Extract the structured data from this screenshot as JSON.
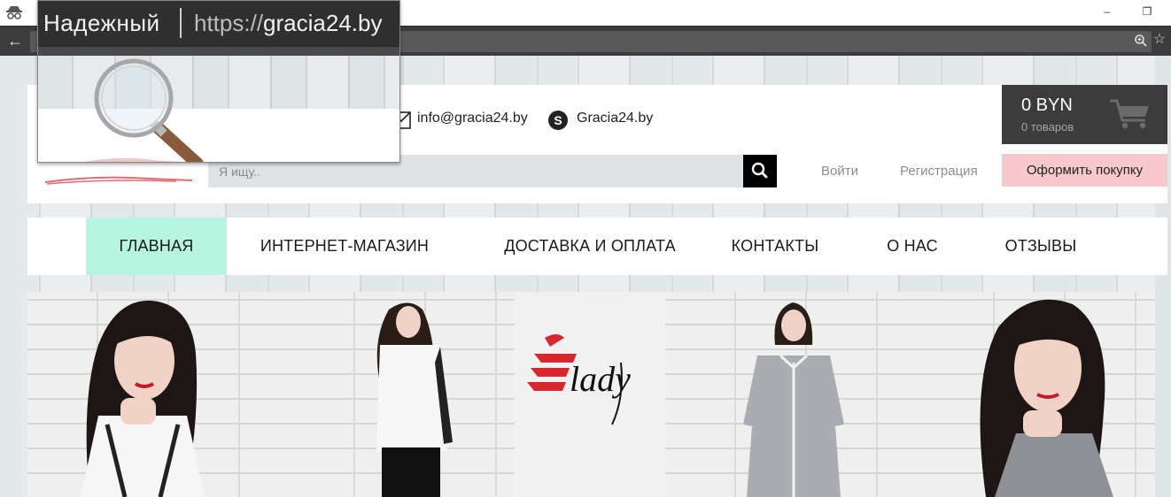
{
  "browser": {
    "secure_label": "Надежный",
    "url_scheme": "https://",
    "url_host": "gracia24.by",
    "icons": [
      "incognito-icon",
      "back-arrow-icon",
      "zoom-icon",
      "bookmark-star-icon",
      "minimize-icon",
      "restore-icon"
    ]
  },
  "header": {
    "email": "info@gracia24.by",
    "skype": "Gracia24.by",
    "search_placeholder": "Я ищу..",
    "login": "Войти",
    "register": "Регистрация",
    "checkout": "Оформить покупку",
    "cart": {
      "total": "0 BYN",
      "count": "0 товаров"
    }
  },
  "nav": {
    "items": [
      {
        "label": "ГЛАВНАЯ",
        "active": true
      },
      {
        "label": "ИНТЕРНЕТ-МАГАЗИН",
        "active": false
      },
      {
        "label": "ДОСТАВКА И ОПЛАТА",
        "active": false
      },
      {
        "label": "КОНТАКТЫ",
        "active": false
      },
      {
        "label": "О НАС",
        "active": false
      },
      {
        "label": "ОТЗЫВЫ",
        "active": false
      }
    ]
  },
  "banner": {
    "brand_logo": "Elady"
  },
  "colors": {
    "nav_active": "#b7f5e1",
    "checkout_bg": "#f8c9cc",
    "cart_bg": "#3c3c3c",
    "brand_red": "#d9272e"
  }
}
